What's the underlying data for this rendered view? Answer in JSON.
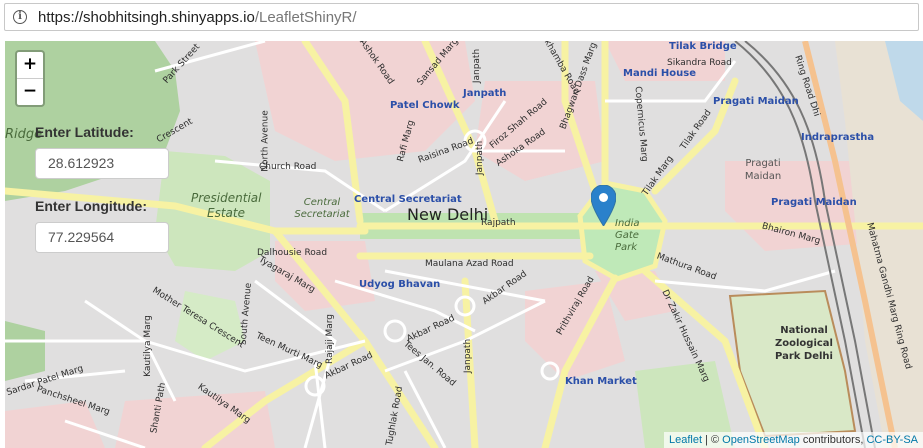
{
  "browser": {
    "url_host": "https://shobhitsingh.shinyapps.io",
    "url_path": "/LeafletShinyR/",
    "info_icon": "info-icon"
  },
  "map": {
    "center_label": "New Delhi",
    "zoom_in": "+",
    "zoom_out": "−",
    "place_labels": [
      "Patel Chowk",
      "Janpath",
      "Mandi House",
      "Tilak Bridge",
      "Pragati Maidan",
      "Indraprastha",
      "Pragati Maidan",
      "Central Secretariat",
      "Udyog Bhavan",
      "Khan Market"
    ],
    "area_labels": [
      "Presidential Estate",
      "Central Secretariat",
      "India Gate Park",
      "Pragati Maidan",
      "National Zoological Park Delhi"
    ],
    "road_labels": [
      "Park Street",
      "Ashok Road",
      "Sansad Marg",
      "Janpath",
      "Barakhamba Road",
      "Bhagwan Dass Marg",
      "Sikandra Road",
      "Ring Road Dhi",
      "North Avenue",
      "Church Road",
      "Rafi Marg",
      "Raisina Road",
      "Janpath",
      "Firoz Shah Road",
      "Ashoka Road",
      "Copernicus Marg",
      "Tilak Road",
      "Tilak Marg",
      "Rajpath",
      "Dalhousie Road",
      "Tyagaraj Marg",
      "Maulana Azad Road",
      "Akbar Road",
      "Mathura Road",
      "Bhairon Marg",
      "Mother Teresa Crescent",
      "South Avenue",
      "Kautilya Marg",
      "Teen Murti Marg",
      "Rajaji Marg",
      "Akbar Road",
      "Tees Jan. Road",
      "Prithviraj Road",
      "Dr Zakir Hussain Marg",
      "Akbar Road",
      "Shanti Path",
      "Panchsheel Marg",
      "Kautilya Marg",
      "Tughlak Road",
      "Janpath",
      "Sardar Patel Marg",
      "Mahatma Gandhi Marg Ring Road",
      "Crescent",
      "Ridge"
    ]
  },
  "inputs": {
    "latitude_label": "Enter Latitude:",
    "latitude_value": "28.612923",
    "longitude_label": "Enter Longitude:",
    "longitude_value": "77.229564"
  },
  "attribution": {
    "leaflet": "Leaflet",
    "sep1": " | © ",
    "osm": "OpenStreetMap",
    "contributors": " contributors, ",
    "license": "CC-BY-SA"
  },
  "colors": {
    "marker": "#2a81cb",
    "park": "#c8e6b4",
    "residential": "#e0dfdf",
    "commercial": "#f2d2d3",
    "major_road": "#f7f2a3",
    "rail": "#777777"
  }
}
